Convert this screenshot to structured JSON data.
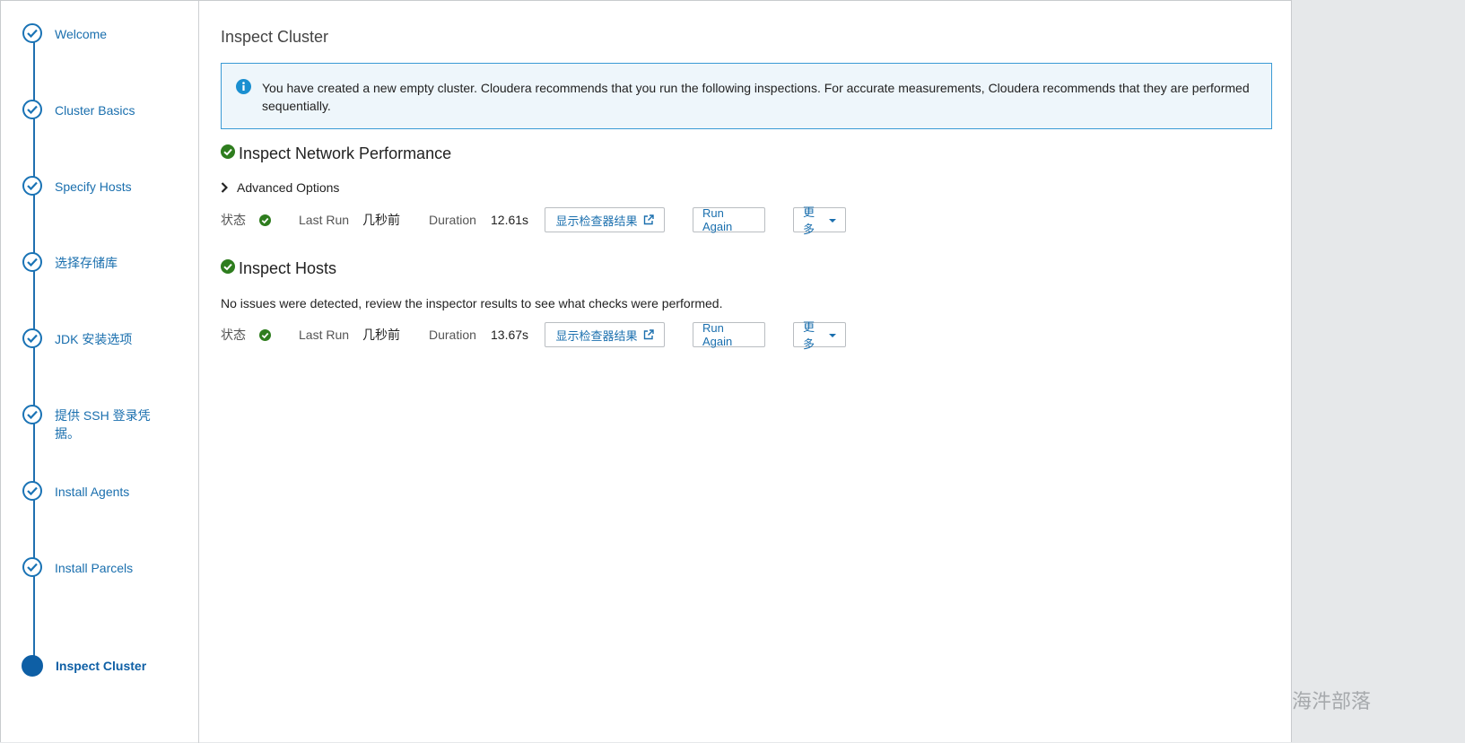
{
  "sidebar": {
    "steps": [
      {
        "label": "Welcome",
        "state": "done"
      },
      {
        "label": "Cluster Basics",
        "state": "done"
      },
      {
        "label": "Specify Hosts",
        "state": "done"
      },
      {
        "label": "选择存储库",
        "state": "done"
      },
      {
        "label": "JDK 安装选项",
        "state": "done"
      },
      {
        "label": "提供 SSH 登录凭据。",
        "state": "done"
      },
      {
        "label": "Install Agents",
        "state": "done"
      },
      {
        "label": "Install Parcels",
        "state": "done"
      },
      {
        "label": "Inspect Cluster",
        "state": "current"
      }
    ]
  },
  "main": {
    "title": "Inspect Cluster",
    "info": "You have created a new empty cluster. Cloudera recommends that you run the following inspections. For accurate measurements, Cloudera recommends that they are performed sequentially.",
    "network": {
      "title": "Inspect Network Performance",
      "advanced_label": "Advanced Options",
      "status_label": "状态",
      "last_run_label": "Last Run",
      "last_run_value": "几秒前",
      "duration_label": "Duration",
      "duration_value": "12.61s",
      "show_results_label": "显示检查器结果",
      "run_again_label": "Run Again",
      "more_label": "更多"
    },
    "hosts": {
      "title": "Inspect Hosts",
      "description": "No issues were detected, review the inspector results to see what checks were performed.",
      "status_label": "状态",
      "last_run_label": "Last Run",
      "last_run_value": "几秒前",
      "duration_label": "Duration",
      "duration_value": "13.67s",
      "show_results_label": "显示检查器结果",
      "run_again_label": "Run Again",
      "more_label": "更多"
    }
  },
  "watermark": "海汼部落",
  "colors": {
    "accent": "#1a6fae",
    "success": "#2e7d1e",
    "info_border": "#3a9ad5",
    "info_bg": "#eef6fb"
  }
}
